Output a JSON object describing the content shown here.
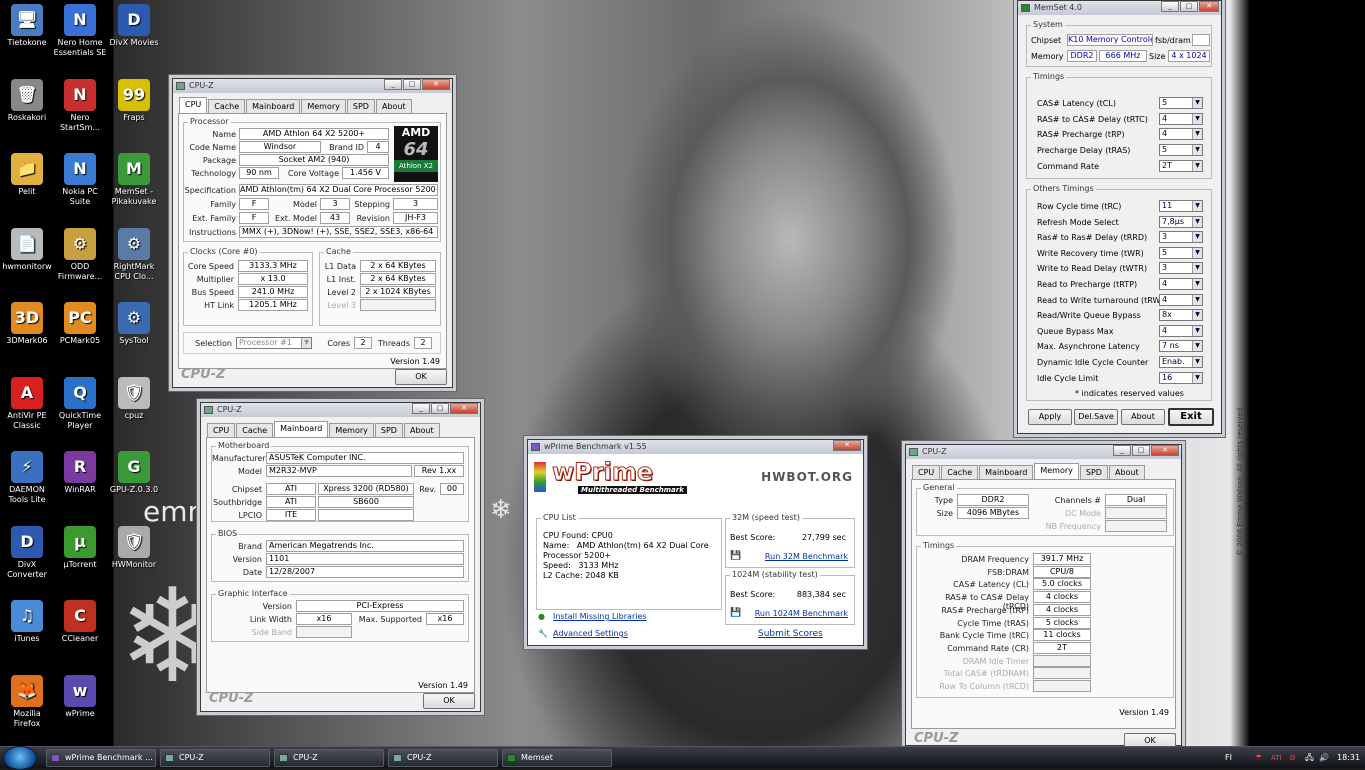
{
  "desktop": {
    "watermark": "emm",
    "copyright": "© 2008 Emma Watson. All rights reserved.",
    "icons": [
      {
        "label": "Tietokone",
        "color": "#4a7cc0",
        "glyph": "🖥",
        "icon": "computer-icon"
      },
      {
        "label": "Nero Home Essentials SE",
        "color": "#3a6fd8",
        "glyph": "N",
        "icon": "nero-home-icon"
      },
      {
        "label": "DivX Movies",
        "color": "#2c5ab0",
        "glyph": "D",
        "icon": "divx-movies-icon"
      },
      {
        "label": "Roskakori",
        "color": "#888",
        "glyph": "🗑",
        "icon": "recycle-bin-icon"
      },
      {
        "label": "Nero StartSm...",
        "color": "#c83030",
        "glyph": "N",
        "icon": "nero-startsmart-icon"
      },
      {
        "label": "Fraps",
        "color": "#d8c000",
        "glyph": "99",
        "icon": "fraps-icon"
      },
      {
        "label": "Pelit",
        "color": "#e0b040",
        "glyph": "📁",
        "icon": "folder-icon"
      },
      {
        "label": "Nokia PC Suite",
        "color": "#3a7ad0",
        "glyph": "N",
        "icon": "nokia-pc-suite-icon"
      },
      {
        "label": "MemSet - Pikakuvake",
        "color": "#3a9a3a",
        "glyph": "M",
        "icon": "memset-icon"
      },
      {
        "label": "hwmonitorw",
        "color": "#bbb",
        "glyph": "📄",
        "icon": "file-icon"
      },
      {
        "label": "ODD Firmware...",
        "color": "#c9a040",
        "glyph": "⚙",
        "icon": "odd-firmware-icon"
      },
      {
        "label": "RightMark CPU Clo...",
        "color": "#5a7aa8",
        "glyph": "⚙",
        "icon": "rightmark-icon"
      },
      {
        "label": "3DMark06",
        "color": "#e08a20",
        "glyph": "3D",
        "icon": "3dmark-icon"
      },
      {
        "label": "PCMark05",
        "color": "#e08a20",
        "glyph": "PC",
        "icon": "pcmark-icon"
      },
      {
        "label": "SysTool",
        "color": "#3a6ab0",
        "glyph": "⚙",
        "icon": "systool-icon"
      },
      {
        "label": "AntiVir PE Classic",
        "color": "#d82020",
        "glyph": "A",
        "icon": "antivir-icon"
      },
      {
        "label": "QuickTime Player",
        "color": "#2a70c8",
        "glyph": "Q",
        "icon": "quicktime-icon"
      },
      {
        "label": "cpuz",
        "color": "#bbb",
        "glyph": "🛡",
        "icon": "cpuz-icon"
      },
      {
        "label": "DAEMON Tools Lite",
        "color": "#3a70c0",
        "glyph": "⚡",
        "icon": "daemon-tools-icon"
      },
      {
        "label": "WinRAR",
        "color": "#7a3aa0",
        "glyph": "R",
        "icon": "winrar-icon"
      },
      {
        "label": "GPU-Z.0.3.0",
        "color": "#3a9a3a",
        "glyph": "G",
        "icon": "gpuz-icon"
      },
      {
        "label": "DivX Converter",
        "color": "#2c5ab0",
        "glyph": "D",
        "icon": "divx-converter-icon"
      },
      {
        "label": "µTorrent",
        "color": "#3a9a30",
        "glyph": "µ",
        "icon": "utorrent-icon"
      },
      {
        "label": "HWMonitor",
        "color": "#aaa",
        "glyph": "🛡",
        "icon": "hwmonitor-icon"
      },
      {
        "label": "iTunes",
        "color": "#4a8ad8",
        "glyph": "♫",
        "icon": "itunes-icon"
      },
      {
        "label": "CCleaner",
        "color": "#c03020",
        "glyph": "C",
        "icon": "ccleaner-icon"
      },
      {
        "label": "",
        "color": "#000",
        "glyph": "",
        "icon": "empty"
      },
      {
        "label": "Mozilla Firefox",
        "color": "#e07020",
        "glyph": "🦊",
        "icon": "firefox-icon"
      },
      {
        "label": "wPrime",
        "color": "#5a4ab0",
        "glyph": "w",
        "icon": "wprime-icon"
      }
    ]
  },
  "cpuz1": {
    "title": "CPU-Z",
    "tabs": [
      "CPU",
      "Cache",
      "Mainboard",
      "Memory",
      "SPD",
      "About"
    ],
    "processor": "Processor",
    "name_l": "Name",
    "name": "AMD Athlon 64 X2 5200+",
    "codename_l": "Code Name",
    "codename": "Windsor",
    "brandid_l": "Brand ID",
    "brandid": "4",
    "package_l": "Package",
    "package": "Socket AM2 (940)",
    "tech_l": "Technology",
    "tech": "90 nm",
    "cv_l": "Core Voltage",
    "cv": "1.456 V",
    "spec_l": "Specification",
    "spec": "AMD Athlon(tm) 64 X2 Dual Core Processor 5200+",
    "family_l": "Family",
    "family": "F",
    "model_l": "Model",
    "model": "3",
    "stepping_l": "Stepping",
    "stepping": "3",
    "extfam_l": "Ext. Family",
    "extfam": "F",
    "extmod_l": "Ext. Model",
    "extmod": "43",
    "rev_l": "Revision",
    "rev": "JH-F3",
    "instr_l": "Instructions",
    "instr": "MMX (+), 3DNow! (+), SSE, SSE2, SSE3, x86-64",
    "logo1": "AMD",
    "logo2": "64",
    "logo3": "Athlon X2",
    "clocks": "Clocks (Core #0)",
    "cs_l": "Core Speed",
    "cs": "3133.3 MHz",
    "mult_l": "Multiplier",
    "mult": "x 13.0",
    "bus_l": "Bus Speed",
    "bus": "241.0 MHz",
    "ht_l": "HT Link",
    "ht": "1205.1 MHz",
    "cache": "Cache",
    "l1d_l": "L1 Data",
    "l1d": "2 x 64 KBytes",
    "l1i_l": "L1 Inst.",
    "l1i": "2 x 64 KBytes",
    "l2_l": "Level 2",
    "l2": "2 x 1024 KBytes",
    "l3_l": "Level 3",
    "selection_l": "Selection",
    "selection": "Processor #1",
    "cores_l": "Cores",
    "cores": "2",
    "threads_l": "Threads",
    "threads": "2",
    "version": "Version 1.49",
    "brand": "CPU-Z",
    "ok": "OK"
  },
  "cpuz2": {
    "title": "CPU-Z",
    "tabs": [
      "CPU",
      "Cache",
      "Mainboard",
      "Memory",
      "SPD",
      "About"
    ],
    "motherboard": "Motherboard",
    "manuf_l": "Manufacturer",
    "manuf": "ASUSTeK Computer INC.",
    "model_l": "Model",
    "model": "M2R32-MVP",
    "rev": "Rev 1.xx",
    "chipset_l": "Chipset",
    "chipset": "ATI",
    "chipset2": "Xpress 3200 (RD580)",
    "rev_l": "Rev.",
    "rev2": "00",
    "south_l": "Southbridge",
    "south": "ATI",
    "south2": "SB600",
    "lpcio_l": "LPCIO",
    "lpcio": "ITE",
    "bios": "BIOS",
    "brand_l": "Brand",
    "brand_v": "American Megatrends Inc.",
    "ver_l": "Version",
    "ver": "1101",
    "date_l": "Date",
    "date": "12/28/2007",
    "gi": "Graphic Interface",
    "giv_l": "Version",
    "giv": "PCI-Express",
    "lw_l": "Link Width",
    "lw": "x16",
    "ms_l": "Max. Supported",
    "ms": "x16",
    "sb_l": "Side Band",
    "version": "Version 1.49",
    "brand": "CPU-Z",
    "ok": "OK"
  },
  "wprime": {
    "title": "wPrime Benchmark v1.55",
    "logo": "wPrime",
    "sub": "Multithreaded Benchmark",
    "hwbot": "HWBOT.ORG",
    "cpulist": "CPU List",
    "cpu_text": "CPU Found: CPU0\nName:   AMD Athlon(tm) 64 X2 Dual Core\nProcessor 5200+\nSpeed:   3133 MHz\nL2 Cache: 2048 KB",
    "t32": "32M (speed test)",
    "best_l": "Best Score:",
    "best32": "27,799 sec",
    "run32": "Run 32M Benchmark",
    "t1024": "1024M (stability test)",
    "best1024": "883,384 sec",
    "run1024": "Run 1024M Benchmark",
    "install": "Install Missing Libraries",
    "adv": "Advanced Settings",
    "submit": "Submit Scores"
  },
  "memset": {
    "title": "MemSet 4.0",
    "system": "System",
    "chipset_l": "Chipset",
    "chipset": "K10 Memory Controler",
    "fsbdram_l": "fsb/dram",
    "memory_l": "Memory",
    "memory": "DDR2",
    "freq": "666 MHz",
    "size_l": "Size",
    "size": "4 x 1024",
    "timings": "Timings",
    "t": [
      {
        "l": "CAS# Latency (tCL)",
        "v": "5"
      },
      {
        "l": "RAS# to CAS# Delay (tRTC)",
        "v": "4"
      },
      {
        "l": "RAS# Precharge (tRP)",
        "v": "4"
      },
      {
        "l": "Precharge Delay  (tRAS)",
        "v": "5"
      },
      {
        "l": "Command Rate",
        "v": "2T"
      }
    ],
    "others": "Others Timings",
    "o": [
      {
        "l": "Row Cycle time (tRC)",
        "v": "11"
      },
      {
        "l": "Refresh Mode Select",
        "v": "7,8µs"
      },
      {
        "l": "Ras# to Ras# Delay (tRRD)",
        "v": "3"
      },
      {
        "l": "Write Recovery time (tWR)",
        "v": "5"
      },
      {
        "l": "Write to Read Delay (tWTR)",
        "v": "3"
      },
      {
        "l": "Read to Precharge (tRTP)",
        "v": "4"
      },
      {
        "l": "Read to Write turnaround (tRW-TO)",
        "v": "4"
      },
      {
        "l": "Read/Write Queue Bypass",
        "v": "8x"
      },
      {
        "l": "Queue Bypass Max",
        "v": "4"
      },
      {
        "l": "Max. Asynchrone Latency",
        "v": "7 ns"
      },
      {
        "l": "Dynamic Idle Cycle Counter",
        "v": "Enab."
      },
      {
        "l": "Idle Cycle Limit",
        "v": "16"
      }
    ],
    "note": "* indicates reserved values",
    "apply": "Apply",
    "delsave": "Del.Save",
    "about": "About",
    "exit": "Exit"
  },
  "cpuz3": {
    "title": "CPU-Z",
    "tabs": [
      "CPU",
      "Cache",
      "Mainboard",
      "Memory",
      "SPD",
      "About"
    ],
    "general": "General",
    "type_l": "Type",
    "type": "DDR2",
    "ch_l": "Channels #",
    "ch": "Dual",
    "size_l": "Size",
    "size": "4096 MBytes",
    "dc_l": "DC Mode",
    "nb_l": "NB Frequency",
    "timings": "Timings",
    "t": [
      {
        "l": "DRAM Frequency",
        "v": "391.7 MHz"
      },
      {
        "l": "FSB:DRAM",
        "v": "CPU/8"
      },
      {
        "l": "CAS# Latency (CL)",
        "v": "5.0 clocks"
      },
      {
        "l": "RAS# to CAS# Delay (tRCD)",
        "v": "4 clocks"
      },
      {
        "l": "RAS# Precharge (tRP)",
        "v": "4 clocks"
      },
      {
        "l": "Cycle Time (tRAS)",
        "v": "5 clocks"
      },
      {
        "l": "Bank Cycle Time (tRC)",
        "v": "11 clocks"
      },
      {
        "l": "Command Rate (CR)",
        "v": "2T"
      },
      {
        "l": "DRAM Idle Timer",
        "v": ""
      },
      {
        "l": "Total CAS# (tRDRAM)",
        "v": ""
      },
      {
        "l": "Row To Column (tRCD)",
        "v": ""
      }
    ],
    "version": "Version 1.49",
    "brand": "CPU-Z",
    "ok": "OK"
  },
  "taskbar": {
    "items": [
      "wPrime Benchmark ...",
      "CPU-Z",
      "CPU-Z",
      "CPU-Z",
      "Memset"
    ],
    "lang": "FI",
    "clock": "18:31"
  }
}
